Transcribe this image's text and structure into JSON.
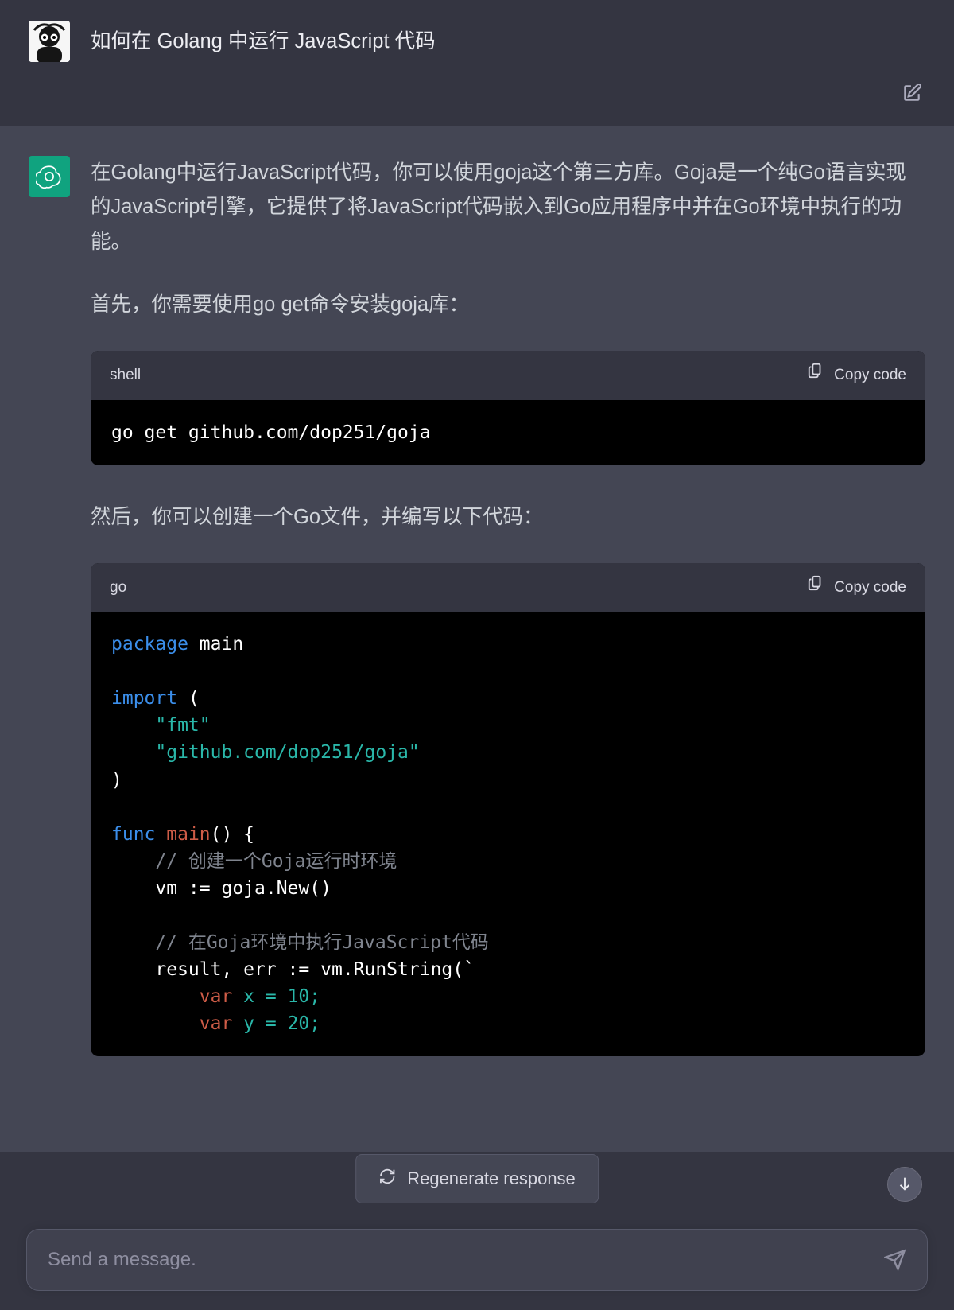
{
  "user": {
    "question": "如何在 Golang 中运行 JavaScript 代码"
  },
  "assistant": {
    "p1": "在Golang中运行JavaScript代码，你可以使用goja这个第三方库。Goja是一个纯Go语言实现的JavaScript引擎，它提供了将JavaScript代码嵌入到Go应用程序中并在Go环境中执行的功能。",
    "p2": "首先，你需要使用go get命令安装goja库：",
    "p3": "然后，你可以创建一个Go文件，并编写以下代码：",
    "code1": {
      "lang": "shell",
      "body": "go get github.com/dop251/goja"
    },
    "code2": {
      "lang": "go",
      "tokens": {
        "kw_package": "package",
        "main1": " main",
        "kw_import": "import",
        "str_fmt": "\"fmt\"",
        "str_goja": "\"github.com/dop251/goja\"",
        "kw_func": "func",
        "fn_main": "main",
        "cmt1": "// 创建一个Goja运行时环境",
        "line_vm": "    vm := goja.New()",
        "cmt2": "// 在Goja环境中执行JavaScript代码",
        "line_run": "    result, err := vm.RunString(`",
        "kw_var1": "var",
        "js_rest1": " x = 10;",
        "kw_var2": "var",
        "js_rest2": " y = 20;"
      }
    }
  },
  "ui": {
    "copy_label": "Copy code",
    "regenerate_label": "Regenerate response",
    "composer_placeholder": "Send a message."
  }
}
